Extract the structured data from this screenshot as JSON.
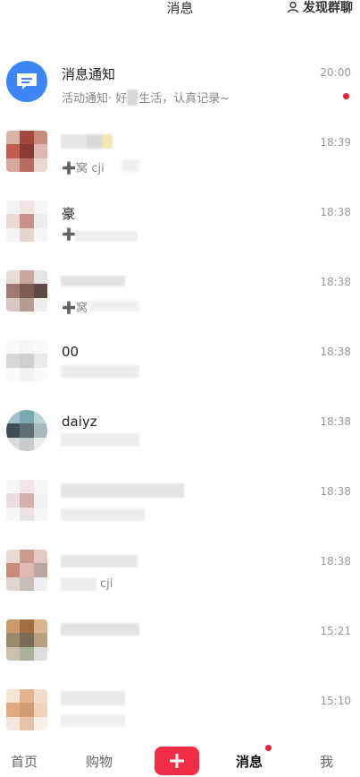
{
  "header": {
    "title": "消息",
    "action_label": "发现群聊",
    "action_icon": "person-icon"
  },
  "conversations": [
    {
      "name": "消息通知",
      "preview": "活动通知· 好好生活，认真记录~",
      "time": "20:00",
      "unread": true,
      "avatar_icon": "chat-bubble-icon"
    },
    {
      "name": "",
      "preview": "➕窝  cji",
      "time": "18:39"
    },
    {
      "name": "豪",
      "preview": "➕",
      "time": "18:38"
    },
    {
      "name": "",
      "preview": "➕窝",
      "time": "18:38"
    },
    {
      "name": "00",
      "preview": "",
      "time": "18:38"
    },
    {
      "name": "daiyz",
      "preview": "",
      "time": "18:38"
    },
    {
      "name": "",
      "preview": "",
      "time": "18:38"
    },
    {
      "name": "",
      "preview": "cji",
      "time": "18:38"
    },
    {
      "name": "",
      "preview": "",
      "time": "15:21"
    },
    {
      "name": "",
      "preview": "",
      "time": "15:10"
    }
  ],
  "tabbar": {
    "home": "首页",
    "shop": "购物",
    "add_icon": "plus-icon",
    "messages": "消息",
    "me": "我"
  },
  "colors": {
    "accent": "#ef2d45",
    "notification_blue": "#3e86f5"
  }
}
